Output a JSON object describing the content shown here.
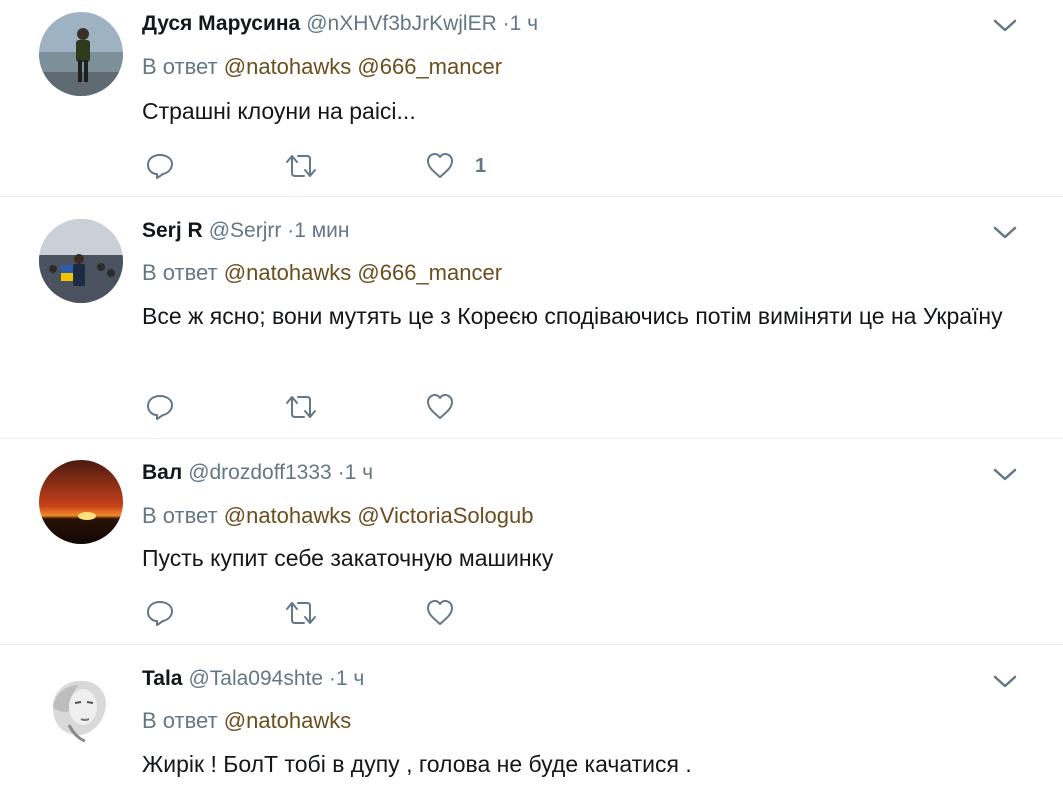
{
  "tweets": [
    {
      "name": "Дуся Марусина",
      "handle": "@nXHVf3bJrKwjlER",
      "dot": "·",
      "time": "1 ч",
      "reply_prefix": "В ответ",
      "mentions": [
        "@natohawks",
        "@666_mancer"
      ],
      "text": "Страшні клоуни на раісі...",
      "like_count": "1"
    },
    {
      "name": "Serj R",
      "handle": "@Serjrr",
      "dot": "·",
      "time": "1 мин",
      "reply_prefix": "В ответ",
      "mentions": [
        "@natohawks",
        "@666_mancer"
      ],
      "text": "Все ж ясно; вони мутять це з Кореєю сподіваючись потім виміняти це на Україну",
      "like_count": ""
    },
    {
      "name": "Вал",
      "handle": "@drozdoff1333",
      "dot": "·",
      "time": "1 ч",
      "reply_prefix": "В ответ",
      "mentions": [
        "@natohawks",
        "@VictoriaSologub"
      ],
      "text": "Пусть купит себе закаточную машинку",
      "like_count": ""
    },
    {
      "name": "Tala",
      "handle": "@Tala094shte",
      "dot": "·",
      "time": "1 ч",
      "reply_prefix": "В ответ",
      "mentions": [
        "@natohawks"
      ],
      "text": "Жирік ! БолТ тобі в дупу ,  голова не буде качатися .",
      "like_count": ""
    }
  ],
  "icons": {
    "reply": "reply-icon",
    "retweet": "retweet-icon",
    "like": "heart-icon",
    "menu": "chevron-down-icon"
  },
  "colors": {
    "secondary_text": "#657786",
    "mention": "#6b4e1e",
    "divider": "#e6ecf0"
  }
}
